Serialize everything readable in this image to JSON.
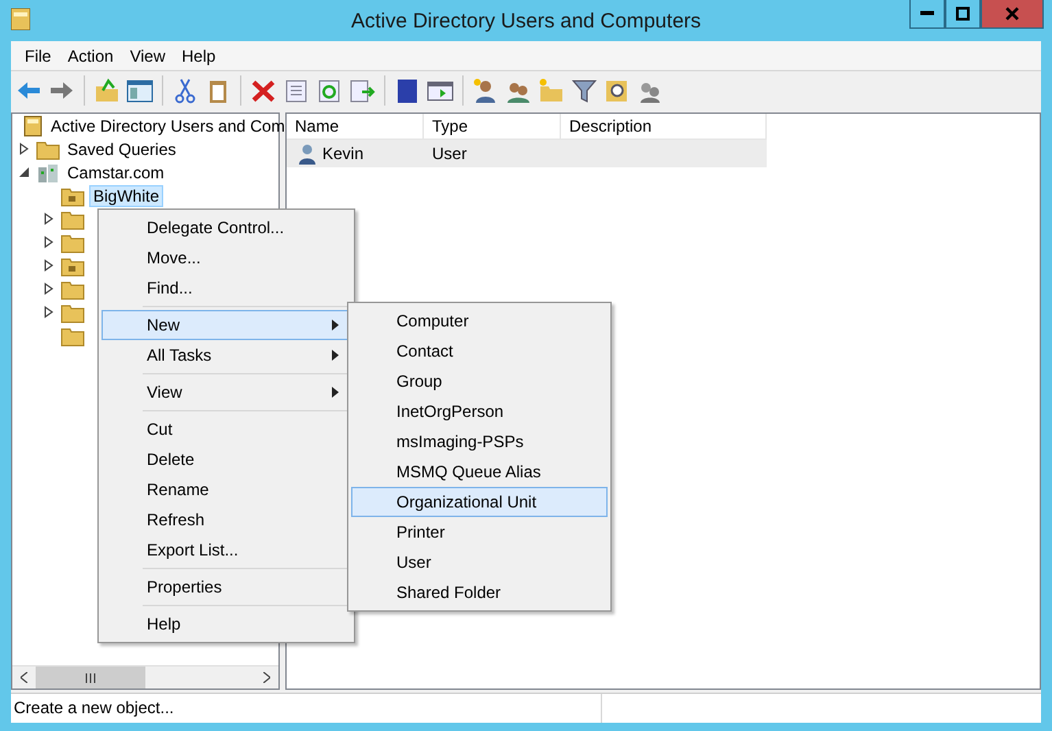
{
  "window": {
    "title": "Active Directory Users and Computers"
  },
  "menu_bar": [
    "File",
    "Action",
    "View",
    "Help"
  ],
  "tree": {
    "label": "Active Directory Users and Com",
    "children": [
      {
        "label": "Saved Queries",
        "kind": "folder",
        "expandable": true,
        "expanded": false,
        "selected": false
      },
      {
        "label": "Camstar.com",
        "kind": "domain",
        "expandable": true,
        "expanded": true,
        "selected": false,
        "children": [
          {
            "label": "BigWhite",
            "kind": "ou",
            "expandable": false,
            "selected": true
          },
          {
            "kind": "folder",
            "expandable": true,
            "expanded": false
          },
          {
            "kind": "folder",
            "expandable": true,
            "expanded": false
          },
          {
            "kind": "ou",
            "expandable": true,
            "expanded": false
          },
          {
            "kind": "folder",
            "expandable": true,
            "expanded": false
          },
          {
            "kind": "folder",
            "expandable": true,
            "expanded": false
          },
          {
            "kind": "folder",
            "expandable": false
          }
        ]
      }
    ]
  },
  "table": {
    "columns": [
      "Name",
      "Type",
      "Description"
    ],
    "rows": [
      {
        "name": "Kevin",
        "type": "User",
        "description": ""
      }
    ]
  },
  "context_menu": {
    "items": [
      {
        "kind": "item",
        "label": "Delegate Control...",
        "submenu": false,
        "selected": false
      },
      {
        "kind": "item",
        "label": "Move...",
        "submenu": false,
        "selected": false
      },
      {
        "kind": "item",
        "label": "Find...",
        "submenu": false,
        "selected": false
      },
      {
        "kind": "separator"
      },
      {
        "kind": "item",
        "label": "New",
        "submenu": true,
        "selected": true
      },
      {
        "kind": "item",
        "label": "All Tasks",
        "submenu": true,
        "selected": false
      },
      {
        "kind": "separator"
      },
      {
        "kind": "item",
        "label": "View",
        "submenu": true,
        "selected": false
      },
      {
        "kind": "separator"
      },
      {
        "kind": "item",
        "label": "Cut",
        "submenu": false,
        "selected": false
      },
      {
        "kind": "item",
        "label": "Delete",
        "submenu": false,
        "selected": false
      },
      {
        "kind": "item",
        "label": "Rename",
        "submenu": false,
        "selected": false
      },
      {
        "kind": "item",
        "label": "Refresh",
        "submenu": false,
        "selected": false
      },
      {
        "kind": "item",
        "label": "Export List...",
        "submenu": false,
        "selected": false
      },
      {
        "kind": "separator"
      },
      {
        "kind": "item",
        "label": "Properties",
        "submenu": false,
        "selected": false
      },
      {
        "kind": "separator"
      },
      {
        "kind": "item",
        "label": "Help",
        "submenu": false,
        "selected": false
      }
    ]
  },
  "submenu": {
    "items": [
      {
        "label": "Computer",
        "selected": false
      },
      {
        "label": "Contact",
        "selected": false
      },
      {
        "label": "Group",
        "selected": false
      },
      {
        "label": "InetOrgPerson",
        "selected": false
      },
      {
        "label": "msImaging-PSPs",
        "selected": false
      },
      {
        "label": "MSMQ Queue Alias",
        "selected": false
      },
      {
        "label": "Organizational Unit",
        "selected": true
      },
      {
        "label": "Printer",
        "selected": false
      },
      {
        "label": "User",
        "selected": false
      },
      {
        "label": "Shared Folder",
        "selected": false
      }
    ]
  },
  "status_bar": "Create a new object..."
}
